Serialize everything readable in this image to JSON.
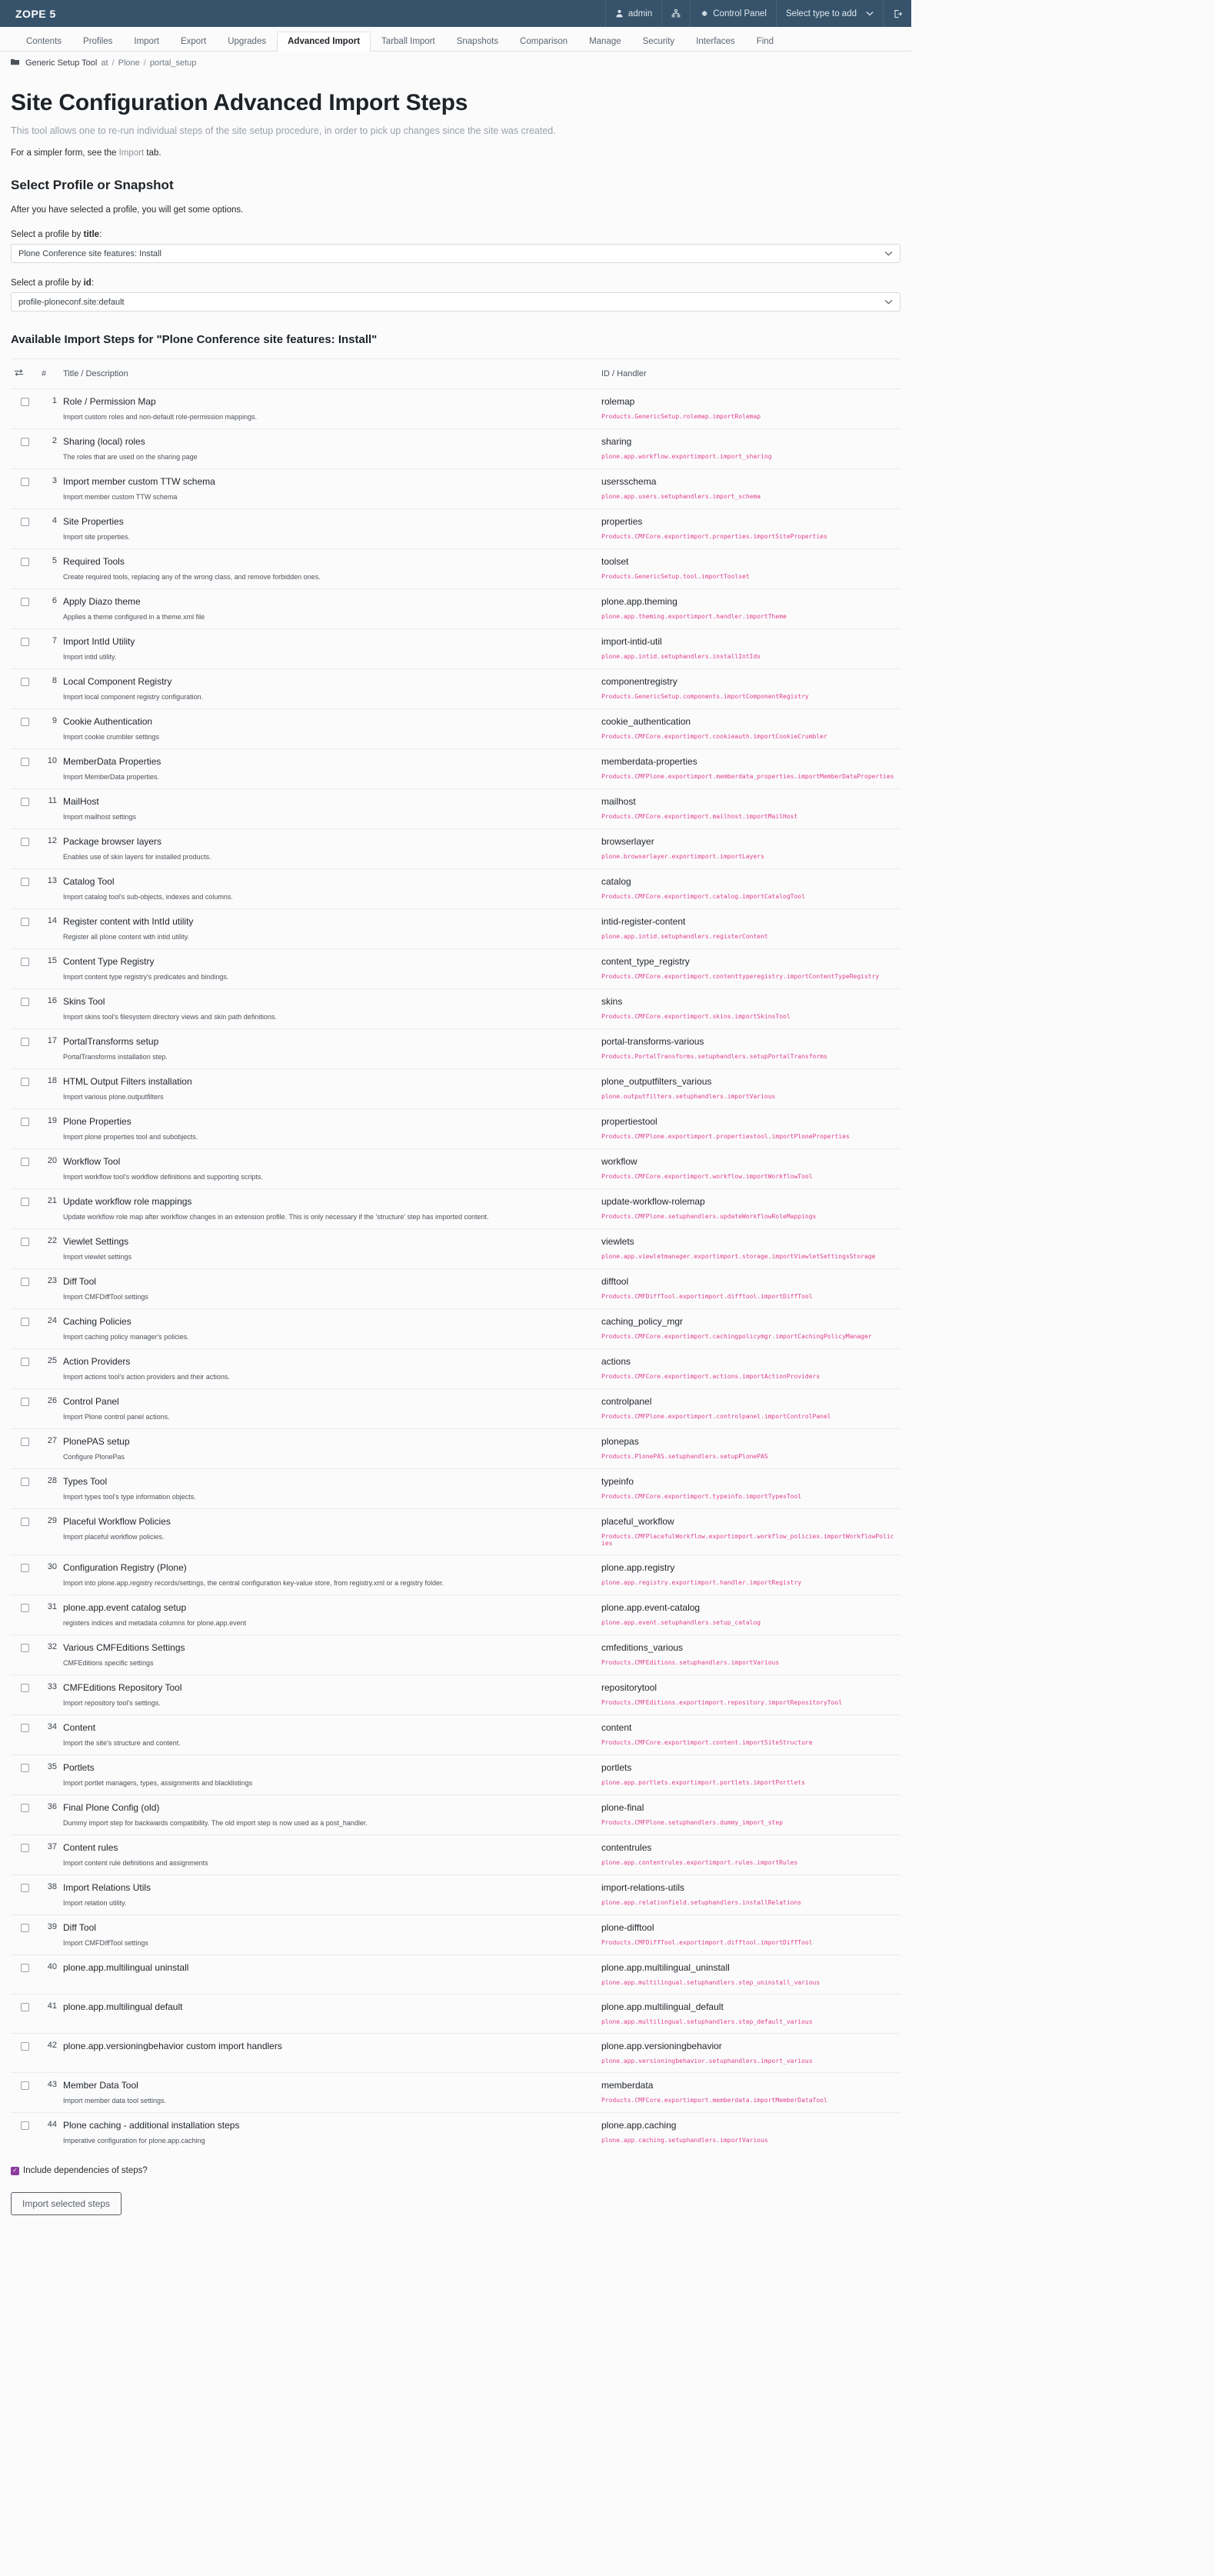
{
  "toolbar": {
    "brand": "ZOPE 5",
    "user": "admin",
    "user_icon": "person-icon",
    "sitemap_icon": "sitemap-icon",
    "gear_icon": "gear-icon",
    "control_panel": "Control Panel",
    "select_type": "Select type to add",
    "caret_icon": "chevron-down-icon",
    "logout_icon": "logout-icon"
  },
  "tabs": [
    {
      "label": "Contents",
      "active": false
    },
    {
      "label": "Profiles",
      "active": false
    },
    {
      "label": "Import",
      "active": false
    },
    {
      "label": "Export",
      "active": false
    },
    {
      "label": "Upgrades",
      "active": false
    },
    {
      "label": "Advanced Import",
      "active": true
    },
    {
      "label": "Tarball Import",
      "active": false
    },
    {
      "label": "Snapshots",
      "active": false
    },
    {
      "label": "Comparison",
      "active": false
    },
    {
      "label": "Manage",
      "active": false
    },
    {
      "label": "Security",
      "active": false
    },
    {
      "label": "Interfaces",
      "active": false
    },
    {
      "label": "Find",
      "active": false
    }
  ],
  "breadcrumb": {
    "icon": "folder-icon",
    "tool": "Generic Setup Tool",
    "at": "at",
    "sep": "/",
    "items": [
      "Plone",
      "portal_setup"
    ]
  },
  "page": {
    "title": "Site Configuration Advanced Import Steps",
    "lede": "This tool allows one to re-run individual steps of the site setup procedure, in order to pick up changes since the site was created.",
    "simpler_prefix": "For a simpler form, see the ",
    "simpler_link": "Import",
    "simpler_suffix": " tab.",
    "section_title": "Select Profile or Snapshot",
    "section_note": "After you have selected a profile, you will get some options.",
    "label_title_prefix": "Select a profile by ",
    "label_title_strong": "title",
    "label_title_suffix": ":",
    "profile_title_value": "Plone Conference site features: Install",
    "label_id_prefix": "Select a profile by ",
    "label_id_strong": "id",
    "label_id_suffix": ":",
    "profile_id_value": "profile-ploneconf.site:default",
    "available_heading": "Available Import Steps for \"Plone Conference site features: Install\"",
    "deps_label": "Include dependencies of steps?",
    "deps_checked": true,
    "import_button": "Import selected steps"
  },
  "table": {
    "headers": {
      "sort": "sort-icon",
      "num": "#",
      "title": "Title / Description",
      "id": "ID / Handler"
    },
    "rows": [
      {
        "n": "1",
        "title": "Role / Permission Map",
        "desc": "Import custom roles and non-default role-permission mappings.",
        "id": "rolemap",
        "handler": "Products.GenericSetup.rolemap.importRolemap"
      },
      {
        "n": "2",
        "title": "Sharing (local) roles",
        "desc": "The roles that are used on the sharing page",
        "id": "sharing",
        "handler": "plone.app.workflow.exportimport.import_sharing"
      },
      {
        "n": "3",
        "title": "Import member custom TTW schema",
        "desc": "Import member custom TTW schema",
        "id": "usersschema",
        "handler": "plone.app.users.setuphandlers.import_schema"
      },
      {
        "n": "4",
        "title": "Site Properties",
        "desc": "Import site properties.",
        "id": "properties",
        "handler": "Products.CMFCore.exportimport.properties.importSiteProperties"
      },
      {
        "n": "5",
        "title": "Required Tools",
        "desc": "Create required tools, replacing any of the wrong class, and remove forbidden ones.",
        "id": "toolset",
        "handler": "Products.GenericSetup.tool.importToolset"
      },
      {
        "n": "6",
        "title": "Apply Diazo theme",
        "desc": "Applies a theme configured in a theme.xml file",
        "id": "plone.app.theming",
        "handler": "plone.app.theming.exportimport.handler.importTheme"
      },
      {
        "n": "7",
        "title": "Import IntId Utility",
        "desc": "Import intid utility.",
        "id": "import-intid-util",
        "handler": "plone.app.intid.setuphandlers.installIntIds"
      },
      {
        "n": "8",
        "title": "Local Component Registry",
        "desc": "Import local component registry configuration.",
        "id": "componentregistry",
        "handler": "Products.GenericSetup.components.importComponentRegistry"
      },
      {
        "n": "9",
        "title": "Cookie Authentication",
        "desc": "Import cookie crumbler settings",
        "id": "cookie_authentication",
        "handler": "Products.CMFCore.exportimport.cookieauth.importCookieCrumbler"
      },
      {
        "n": "10",
        "title": "MemberData Properties",
        "desc": "Import MemberData properties.",
        "id": "memberdata-properties",
        "handler": "Products.CMFPlone.exportimport.memberdata_properties.importMemberDataProperties"
      },
      {
        "n": "11",
        "title": "MailHost",
        "desc": "Import mailhost settings",
        "id": "mailhost",
        "handler": "Products.CMFCore.exportimport.mailhost.importMailHost"
      },
      {
        "n": "12",
        "title": "Package browser layers",
        "desc": "Enables use of skin layers for installed products.",
        "id": "browserlayer",
        "handler": "plone.browserlayer.exportimport.importLayers"
      },
      {
        "n": "13",
        "title": "Catalog Tool",
        "desc": "Import catalog tool's sub-objects, indexes and columns.",
        "id": "catalog",
        "handler": "Products.CMFCore.exportimport.catalog.importCatalogTool"
      },
      {
        "n": "14",
        "title": "Register content with IntId utility",
        "desc": "Register all plone content with intid utility.",
        "id": "intid-register-content",
        "handler": "plone.app.intid.setuphandlers.registerContent"
      },
      {
        "n": "15",
        "title": "Content Type Registry",
        "desc": "Import content type registry's predicates and bindings.",
        "id": "content_type_registry",
        "handler": "Products.CMFCore.exportimport.contenttyperegistry.importContentTypeRegistry"
      },
      {
        "n": "16",
        "title": "Skins Tool",
        "desc": "Import skins tool's filesystem directory views and skin path definitions.",
        "id": "skins",
        "handler": "Products.CMFCore.exportimport.skins.importSkinsTool"
      },
      {
        "n": "17",
        "title": "PortalTransforms setup",
        "desc": "PortalTransforms installation step.",
        "id": "portal-transforms-various",
        "handler": "Products.PortalTransforms.setuphandlers.setupPortalTransforms"
      },
      {
        "n": "18",
        "title": "HTML Output Filters installation",
        "desc": "Import various plone.outputfilters",
        "id": "plone_outputfilters_various",
        "handler": "plone.outputfilters.setuphandlers.importVarious"
      },
      {
        "n": "19",
        "title": "Plone Properties",
        "desc": "Import plone properties tool and subobjects.",
        "id": "propertiestool",
        "handler": "Products.CMFPlone.exportimport.propertiestool.importPloneProperties"
      },
      {
        "n": "20",
        "title": "Workflow Tool",
        "desc": "Import workflow tool's workflow definitions and supporting scripts.",
        "id": "workflow",
        "handler": "Products.CMFCore.exportimport.workflow.importWorkflowTool"
      },
      {
        "n": "21",
        "title": "Update workflow role mappings",
        "desc": "Update workflow role map after workflow changes in an extension profile. This is only necessary if the 'structure' step has imported content.",
        "id": "update-workflow-rolemap",
        "handler": "Products.CMFPlone.setuphandlers.updateWorkflowRoleMappings"
      },
      {
        "n": "22",
        "title": "Viewlet Settings",
        "desc": "Import viewlet settings",
        "id": "viewlets",
        "handler": "plone.app.viewletmanager.exportimport.storage.importViewletSettingsStorage"
      },
      {
        "n": "23",
        "title": "Diff Tool",
        "desc": "Import CMFDiffTool settings",
        "id": "difftool",
        "handler": "Products.CMFDiffTool.exportimport.difftool.importDiffTool"
      },
      {
        "n": "24",
        "title": "Caching Policies",
        "desc": "Import caching policy manager's policies.",
        "id": "caching_policy_mgr",
        "handler": "Products.CMFCore.exportimport.cachingpolicymgr.importCachingPolicyManager"
      },
      {
        "n": "25",
        "title": "Action Providers",
        "desc": "Import actions tool's action providers and their actions.",
        "id": "actions",
        "handler": "Products.CMFCore.exportimport.actions.importActionProviders"
      },
      {
        "n": "26",
        "title": "Control Panel",
        "desc": "Import Plone control panel actions.",
        "id": "controlpanel",
        "handler": "Products.CMFPlone.exportimport.controlpanel.importControlPanel"
      },
      {
        "n": "27",
        "title": "PlonePAS setup",
        "desc": "Configure PlonePas",
        "id": "plonepas",
        "handler": "Products.PlonePAS.setuphandlers.setupPlonePAS"
      },
      {
        "n": "28",
        "title": "Types Tool",
        "desc": "Import types tool's type information objects.",
        "id": "typeinfo",
        "handler": "Products.CMFCore.exportimport.typeinfo.importTypesTool"
      },
      {
        "n": "29",
        "title": "Placeful Workflow Policies",
        "desc": "Import placeful workflow policies.",
        "id": "placeful_workflow",
        "handler": "Products.CMFPlacefulWorkflow.exportimport.workflow_policies.importWorkflowPolicies"
      },
      {
        "n": "30",
        "title": "Configuration Registry (Plone)",
        "desc": "Import into plone.app.registry records/settings, the central configuration key-value store, from registry.xml or a registry folder.",
        "id": "plone.app.registry",
        "handler": "plone.app.registry.exportimport.handler.importRegistry"
      },
      {
        "n": "31",
        "title": "plone.app.event catalog setup",
        "desc": "registers indices and metadata columns for plone.app.event",
        "id": "plone.app.event-catalog",
        "handler": "plone.app.event.setuphandlers.setup_catalog"
      },
      {
        "n": "32",
        "title": "Various CMFEditions Settings",
        "desc": "CMFEditions specific settings",
        "id": "cmfeditions_various",
        "handler": "Products.CMFEditions.setuphandlers.importVarious"
      },
      {
        "n": "33",
        "title": "CMFEditions Repository Tool",
        "desc": "Import repository tool's settings.",
        "id": "repositorytool",
        "handler": "Products.CMFEditions.exportimport.repository.importRepositoryTool"
      },
      {
        "n": "34",
        "title": "Content",
        "desc": "Import the site's structure and content.",
        "id": "content",
        "handler": "Products.CMFCore.exportimport.content.importSiteStructure"
      },
      {
        "n": "35",
        "title": "Portlets",
        "desc": "Import portlet managers, types, assignments and blacklistings",
        "id": "portlets",
        "handler": "plone.app.portlets.exportimport.portlets.importPortlets"
      },
      {
        "n": "36",
        "title": "Final Plone Config (old)",
        "desc": "Dummy import step for backwards compatibility. The old import step is now used as a post_handler.",
        "id": "plone-final",
        "handler": "Products.CMFPlone.setuphandlers.dummy_import_step"
      },
      {
        "n": "37",
        "title": "Content rules",
        "desc": "Import content rule definitions and assignments",
        "id": "contentrules",
        "handler": "plone.app.contentrules.exportimport.rules.importRules"
      },
      {
        "n": "38",
        "title": "Import Relations Utils",
        "desc": "Import relation utility.",
        "id": "import-relations-utils",
        "handler": "plone.app.relationfield.setuphandlers.installRelations"
      },
      {
        "n": "39",
        "title": "Diff Tool",
        "desc": "Import CMFDiffTool settings",
        "id": "plone-difftool",
        "handler": "Products.CMFDiffTool.exportimport.difftool.importDiffTool"
      },
      {
        "n": "40",
        "title": "plone.app.multilingual uninstall",
        "desc": "",
        "id": "plone.app.multilingual_uninstall",
        "handler": "plone.app.multilingual.setuphandlers.step_uninstall_various"
      },
      {
        "n": "41",
        "title": "plone.app.multilingual default",
        "desc": "",
        "id": "plone.app.multilingual_default",
        "handler": "plone.app.multilingual.setuphandlers.step_default_various"
      },
      {
        "n": "42",
        "title": "plone.app.versioningbehavior custom import handlers",
        "desc": "",
        "id": "plone.app.versioningbehavior",
        "handler": "plone.app.versioningbehavior.setuphandlers.import_various"
      },
      {
        "n": "43",
        "title": "Member Data Tool",
        "desc": "Import member data tool settings.",
        "id": "memberdata",
        "handler": "Products.CMFCore.exportimport.memberdata.importMemberDataTool"
      },
      {
        "n": "44",
        "title": "Plone caching - additional installation steps",
        "desc": "Imperative configuration for plone.app.caching",
        "id": "plone.app.caching",
        "handler": "plone.app.caching.setuphandlers.importVarious"
      }
    ]
  },
  "colors": {
    "toolbar_bg": "#36536b",
    "handler_pink": "#e0418c",
    "checkbox_on": "#8e3a9c"
  }
}
